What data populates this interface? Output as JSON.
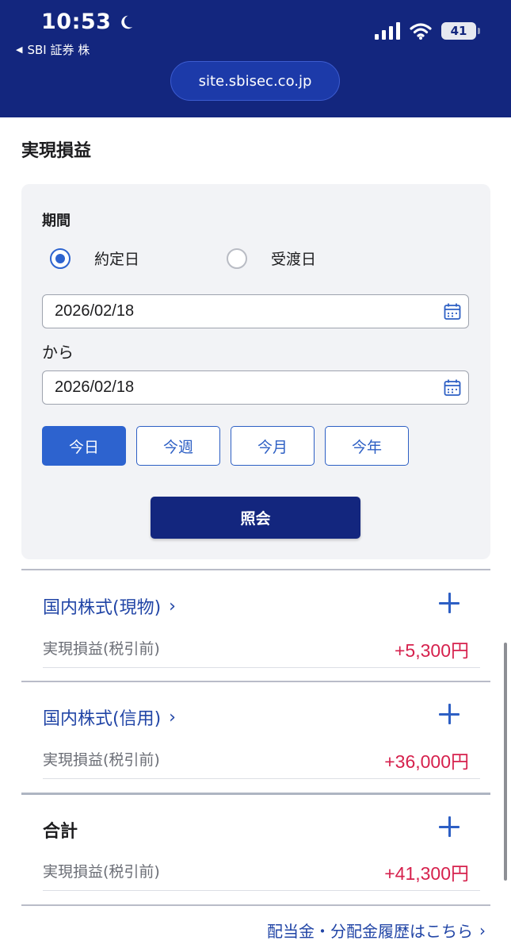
{
  "status_bar": {
    "time": "10:53",
    "back_app": "SBI 証券 株",
    "battery": "41"
  },
  "browser": {
    "url": "site.sbisec.co.jp"
  },
  "page": {
    "title": "実現損益"
  },
  "filter": {
    "period_label": "期間",
    "radio_options": [
      {
        "label": "約定日",
        "selected": true
      },
      {
        "label": "受渡日",
        "selected": false
      }
    ],
    "date_from": "2026/02/18",
    "range_connector": "から",
    "date_to": "2026/02/18",
    "quick_buttons": [
      {
        "label": "今日",
        "active": true
      },
      {
        "label": "今週",
        "active": false
      },
      {
        "label": "今月",
        "active": false
      },
      {
        "label": "今年",
        "active": false
      }
    ],
    "submit_label": "照会"
  },
  "results": [
    {
      "category": "国内株式(現物)",
      "chevron": "›",
      "label": "実現損益(税引前)",
      "value": "+5,300円"
    },
    {
      "category": "国内株式(信用)",
      "chevron": "›",
      "label": "実現損益(税引前)",
      "value": "+36,000円"
    },
    {
      "category": "合計",
      "chevron": "",
      "label": "実現損益(税引前)",
      "value": "+41,300円"
    }
  ],
  "footer": {
    "link": "配当金・分配金履歴はこちら",
    "chevron": "›"
  },
  "colors": {
    "header": "#13267e",
    "accent": "#2d63cf",
    "positive": "#d6214d",
    "link": "#2145a6"
  },
  "icons": [
    "moon-icon",
    "signal-icon",
    "wifi-icon",
    "battery-icon",
    "calendar-icon",
    "plus-icon",
    "chevron-right-icon"
  ]
}
